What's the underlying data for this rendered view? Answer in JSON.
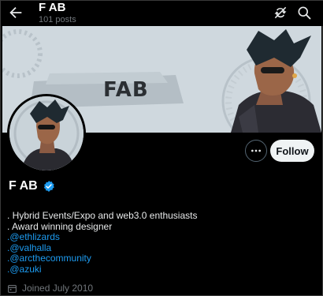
{
  "header": {
    "title": "F AB",
    "posts_count": "101 posts",
    "icons": [
      "back-arrow-icon",
      "rotate-icon",
      "search-icon"
    ]
  },
  "banner": {
    "text": "FAB"
  },
  "actions": {
    "follow_label": "Follow",
    "more_icon": "more-horizontal-icon"
  },
  "profile": {
    "display_name": "F AB",
    "verified": true,
    "bio_lines": [
      ". Hybrid Events/Expo and web3.0 enthusiasts",
      ". Award winning designer"
    ],
    "links": [
      ".@ethlizards",
      ".@valhalla",
      ".@arcthecommunity",
      ".@azuki"
    ],
    "joined": "Joined July 2010"
  },
  "colors": {
    "background": "#000000",
    "accent": "#1d9bf0",
    "muted": "#71767b",
    "follow_button": "#eff3f4"
  }
}
